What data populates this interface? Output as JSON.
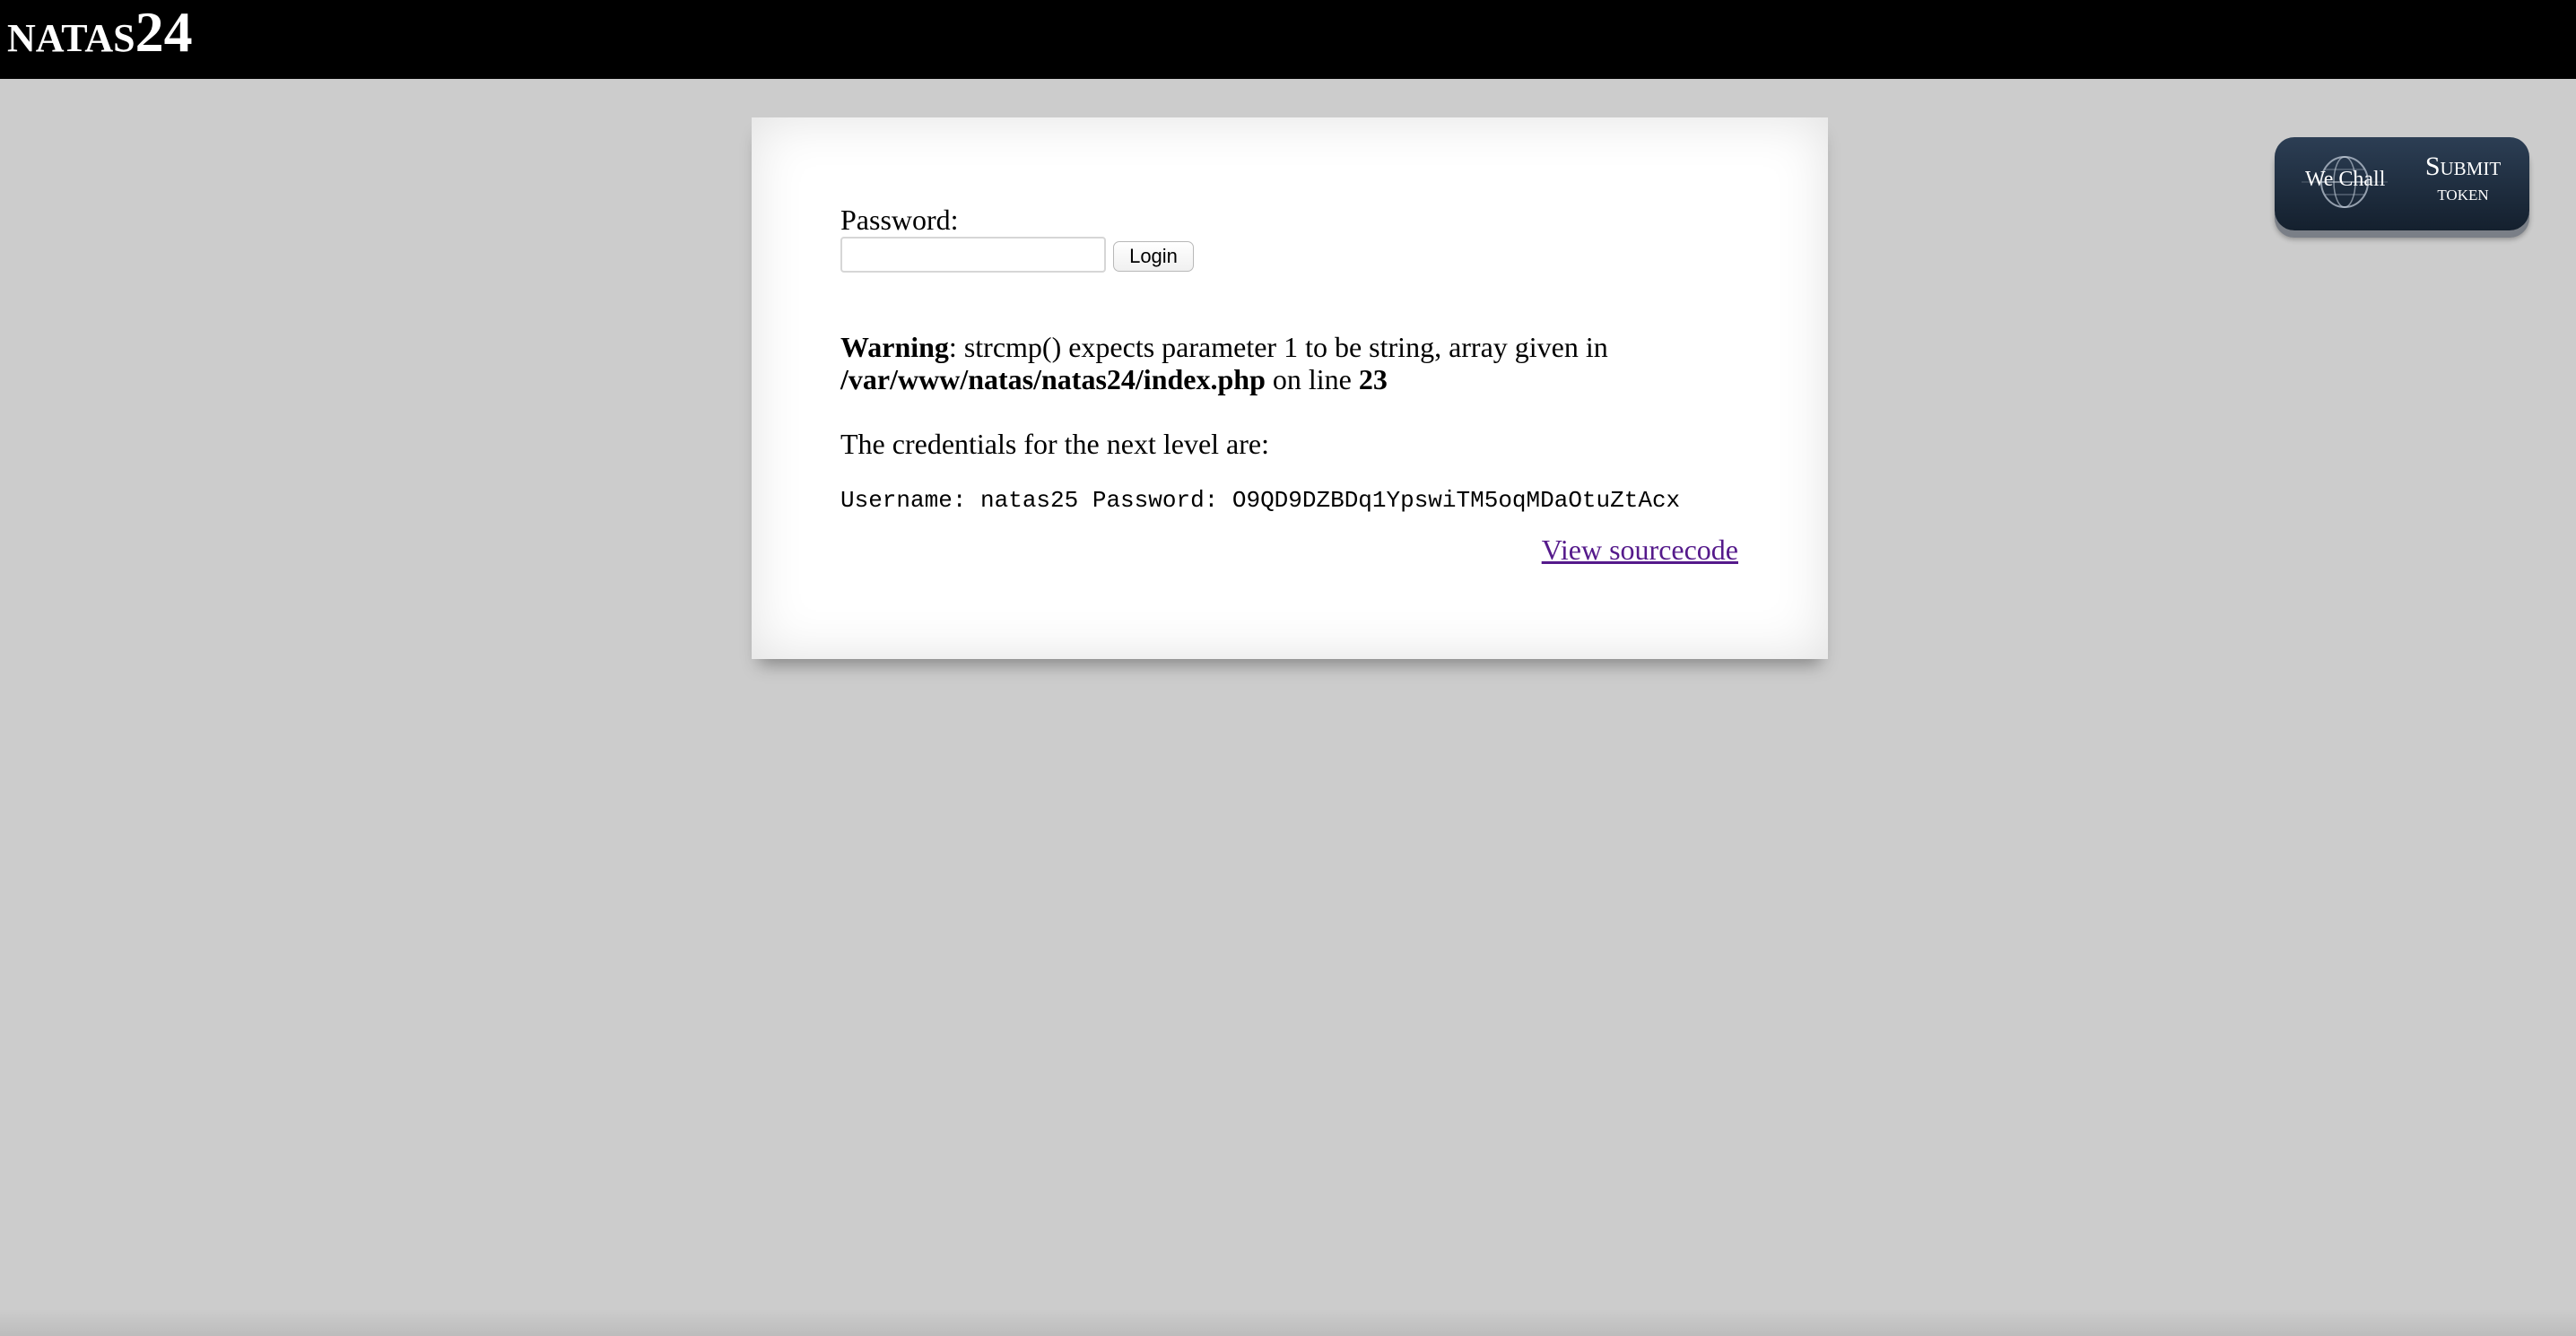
{
  "header": {
    "title_name": "NATAS",
    "title_number": "24"
  },
  "form": {
    "password_label": "Password:",
    "password_value": "",
    "login_label": "Login"
  },
  "warning": {
    "label": "Warning",
    "message": ": strcmp() expects parameter 1 to be string, array given in",
    "file_path": "/var/www/natas/natas24/index.php",
    "on_line_text": " on line ",
    "line_number": "23"
  },
  "credentials": {
    "intro": "The credentials for the next level are:",
    "line": "Username: natas25 Password: O9QD9DZBDq1YpswiTM5oqMDaOtuZtAcx"
  },
  "links": {
    "view_source": "View sourcecode"
  },
  "wechall": {
    "logo_text": "We Chall",
    "submit_line1": "Submit",
    "submit_line2": "token"
  },
  "colors": {
    "header_bg": "#000000",
    "page_bg": "#cccccc",
    "link_visited": "#551a8b",
    "wechall_bg": "#1f2f42"
  }
}
